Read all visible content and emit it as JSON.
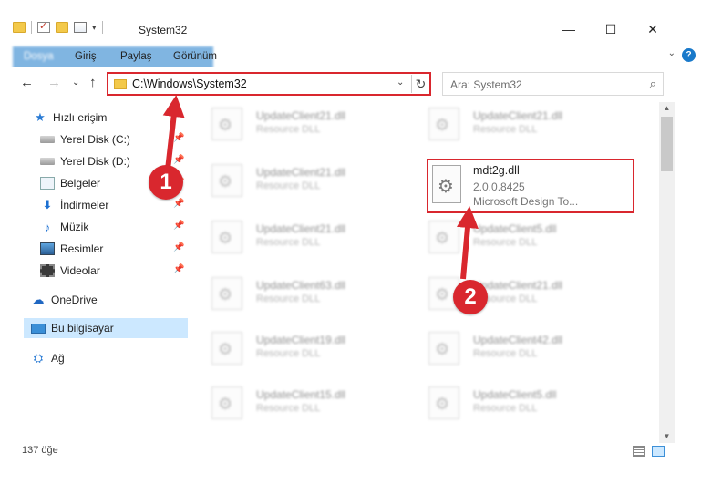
{
  "window": {
    "title": "System32",
    "minimize": "—",
    "maximize": "☐",
    "close": "✕"
  },
  "ribbon": {
    "tabs": [
      "Dosya",
      "Giriş",
      "Paylaş",
      "Görünüm"
    ],
    "help": "?",
    "collapse": "⌄"
  },
  "navigation": {
    "back": "←",
    "forward": "→",
    "recent": "⌄",
    "up": "↑",
    "address": "C:\\Windows\\System32",
    "address_dropdown": "⌄",
    "refresh": "↻",
    "search_placeholder": "Ara: System32",
    "search_icon": "⌕"
  },
  "sidebar": {
    "items": [
      {
        "label": "Hızlı erişim",
        "icon": "star-icon",
        "glyph": "★",
        "pinned": false
      },
      {
        "label": "Yerel Disk (C:)",
        "icon": "drive-icon",
        "glyph": "",
        "pinned": true
      },
      {
        "label": "Yerel Disk (D:)",
        "icon": "drive-icon",
        "glyph": "",
        "pinned": true
      },
      {
        "label": "Belgeler",
        "icon": "documents-icon",
        "glyph": "",
        "pinned": true
      },
      {
        "label": "İndirmeler",
        "icon": "downloads-icon",
        "glyph": "⬇",
        "pinned": true
      },
      {
        "label": "Müzik",
        "icon": "music-icon",
        "glyph": "♪",
        "pinned": true
      },
      {
        "label": "Resimler",
        "icon": "pictures-icon",
        "glyph": "",
        "pinned": true
      },
      {
        "label": "Videolar",
        "icon": "videos-icon",
        "glyph": "",
        "pinned": true
      },
      {
        "label": "OneDrive",
        "icon": "cloud-icon",
        "glyph": "☁",
        "pinned": false
      },
      {
        "label": "Bu bilgisayar",
        "icon": "computer-icon",
        "glyph": "",
        "pinned": false,
        "selected": true
      },
      {
        "label": "Ağ",
        "icon": "network-icon",
        "glyph": "⛭",
        "pinned": false
      }
    ],
    "pin_glyph": "📌"
  },
  "files_left": [
    {
      "name": "UpdateClient21.dll",
      "type": "Resource DLL"
    },
    {
      "name": "UpdateClient21.dll",
      "type": "Resource DLL"
    },
    {
      "name": "UpdateClient21.dll",
      "type": "Resource DLL"
    },
    {
      "name": "UpdateClient63.dll",
      "type": "Resource DLL"
    },
    {
      "name": "UpdateClient19.dll",
      "type": "Resource DLL"
    },
    {
      "name": "UpdateClient15.dll",
      "type": "Resource DLL"
    }
  ],
  "files_right": [
    {
      "name": "UpdateClient21.dll",
      "type": "Resource DLL"
    },
    {
      "name": "UpdateClient5.dll",
      "type": "Resource DLL"
    },
    {
      "name": "UpdateClient21.dll",
      "type": "Resource DLL"
    },
    {
      "name": "UpdateClient42.dll",
      "type": "Resource DLL"
    },
    {
      "name": "UpdateClient5.dll",
      "type": "Resource DLL"
    }
  ],
  "target_file": {
    "name": "mdt2g.dll",
    "version": "2.0.0.8425",
    "description": "Microsoft Design To..."
  },
  "annotations": {
    "step1": "1",
    "step2": "2",
    "highlight_color": "#d9272e"
  },
  "status": {
    "item_count": "137 öğe"
  },
  "colors": {
    "accent": "#1979ca",
    "selection": "#cce8ff"
  }
}
